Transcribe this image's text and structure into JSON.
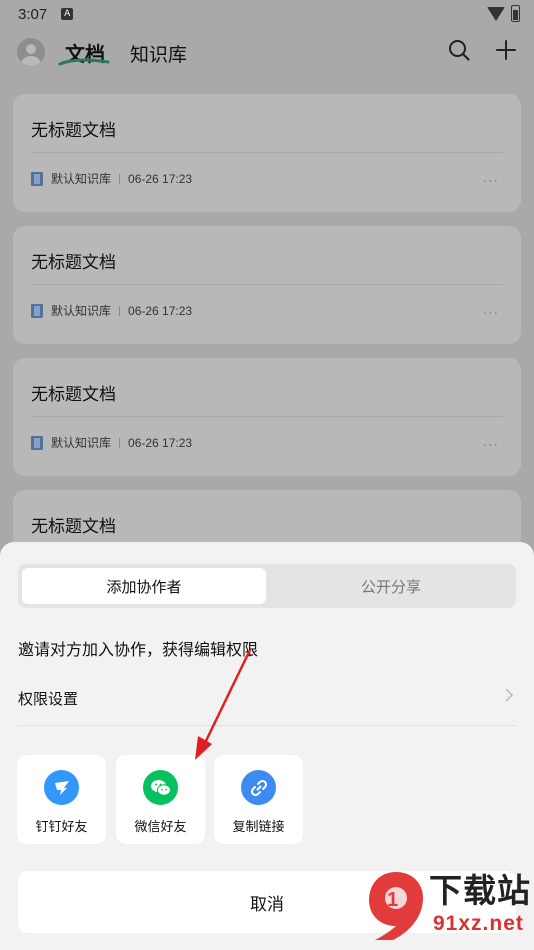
{
  "status_bar": {
    "time": "3:07",
    "notification_letter": "A"
  },
  "header": {
    "tab_docs": "文档",
    "tab_kb": "知识库"
  },
  "cards": [
    {
      "title": "无标题文档",
      "kb": "默认知识库",
      "time": "06-26 17:23"
    },
    {
      "title": "无标题文档",
      "kb": "默认知识库",
      "time": "06-26 17:23"
    },
    {
      "title": "无标题文档",
      "kb": "默认知识库",
      "time": "06-26 17:23"
    },
    {
      "title": "无标题文档"
    }
  ],
  "more_label": "···",
  "sheet": {
    "tabs": {
      "active": "添加协作者",
      "inactive": "公开分享"
    },
    "invite_text": "邀请对方加入协作，获得编辑权限",
    "permission_label": "权限设置",
    "share_options": [
      {
        "label": "钉钉好友",
        "icon": "dingtalk-icon",
        "color": "#3296fa"
      },
      {
        "label": "微信好友",
        "icon": "wechat-icon",
        "color": "#07c160"
      },
      {
        "label": "复制链接",
        "icon": "link-icon",
        "color": "#3d8bf2"
      }
    ],
    "cancel_label": "取消"
  },
  "watermark": {
    "top": "下载站",
    "bottom": "91xz.net"
  },
  "colors": {
    "accent_green": "#07c160",
    "accent_blue": "#3296fa",
    "arrow_red": "#e02020"
  }
}
